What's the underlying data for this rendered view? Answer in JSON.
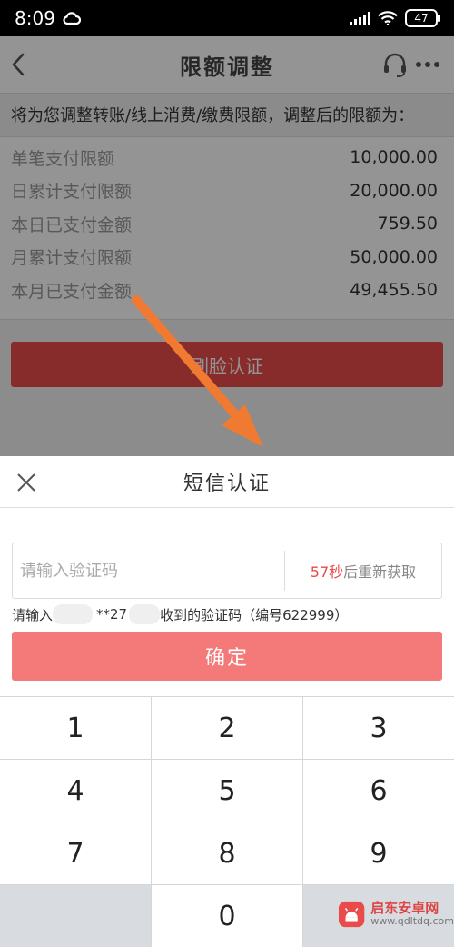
{
  "status": {
    "time": "8:09",
    "battery": "47",
    "icons": [
      "cloud-icon",
      "signal-icon",
      "wifi-icon",
      "battery-icon"
    ]
  },
  "header": {
    "title": "限额调整",
    "icons": [
      "back-icon",
      "headset-icon",
      "more-icon"
    ]
  },
  "intro": "将为您调整转账/线上消费/缴费限额，调整后的限额为：",
  "limits": [
    {
      "label": "单笔支付限额",
      "value": "10,000.00"
    },
    {
      "label": "日累计支付限额",
      "value": "20,000.00"
    },
    {
      "label": "本日已支付金额",
      "value": "759.50"
    },
    {
      "label": "月累计支付限额",
      "value": "50,000.00"
    },
    {
      "label": "本月已支付金额",
      "value": "49,455.50"
    }
  ],
  "face_button": {
    "label": "刷脸认证"
  },
  "sheet": {
    "title": "短信认证",
    "code_placeholder": "请输入验证码",
    "countdown": "57秒",
    "resend_suffix": "后重新获取",
    "hint_prefix": "请输入",
    "hint_mid": "**27",
    "hint_suffix": "收到的验证码（编号622999）",
    "confirm_label": "确定"
  },
  "keypad": [
    [
      "1",
      "2",
      "3"
    ],
    [
      "4",
      "5",
      "6"
    ],
    [
      "7",
      "8",
      "9"
    ],
    [
      "",
      "0",
      ""
    ]
  ],
  "watermark": {
    "name": "启东安卓网",
    "url": "www.qdltdq.com"
  },
  "colors": {
    "accent": "#e94a4a",
    "confirm": "#f47a7a",
    "annotation_arrow": "#f07a32"
  }
}
